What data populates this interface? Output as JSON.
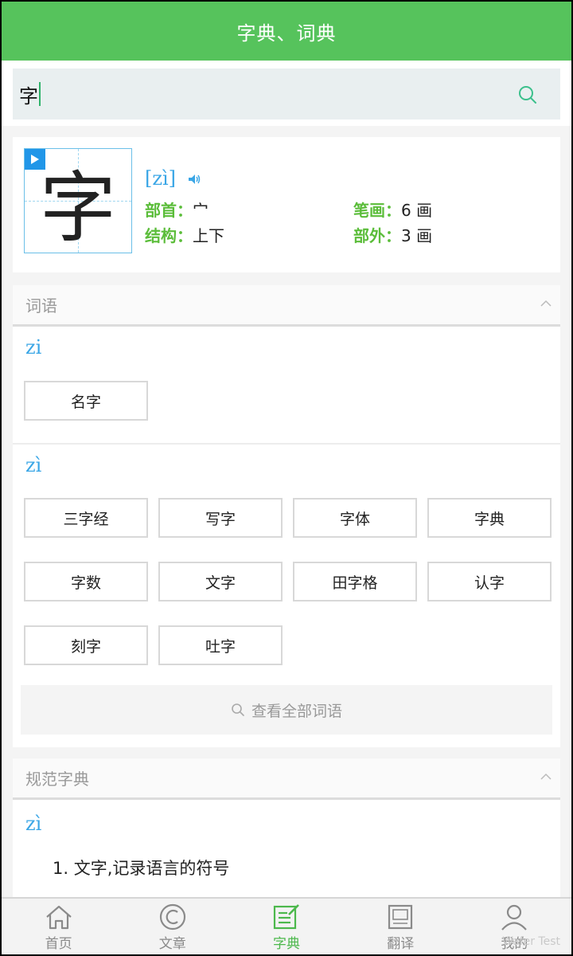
{
  "header": {
    "title": "字典、词典"
  },
  "search": {
    "value": "字"
  },
  "char_card": {
    "character": "字",
    "pinyin": "[zì]",
    "radical_label": "部首：",
    "radical_value": "宀",
    "strokes_label": "笔画：",
    "strokes_value": "6 画",
    "structure_label": "结构：",
    "structure_value": "上下",
    "extra_label": "部外：",
    "extra_value": "3 画"
  },
  "words": {
    "heading": "词语",
    "groups": [
      {
        "pinyin": "zi",
        "items": [
          "名字"
        ]
      },
      {
        "pinyin": "zì",
        "items": [
          "三字经",
          "写字",
          "字体",
          "字典",
          "字数",
          "文字",
          "田字格",
          "认字",
          "刻字",
          "吐字"
        ]
      }
    ],
    "view_all": "查看全部词语"
  },
  "dictionary": {
    "heading": "规范字典",
    "pinyin": "zì",
    "definitions": [
      "1. 文字,记录语言的符号"
    ]
  },
  "nav": {
    "items": [
      {
        "label": "首页",
        "icon": "home-icon"
      },
      {
        "label": "文章",
        "icon": "copyright-icon"
      },
      {
        "label": "字典",
        "icon": "edit-note-icon",
        "active": true
      },
      {
        "label": "翻译",
        "icon": "translate-card-icon"
      },
      {
        "label": "我的",
        "icon": "user-icon"
      }
    ],
    "active_color": "#4cb84c"
  },
  "watermark": "Wafer Test",
  "colors": {
    "header": "#56c35c",
    "accent_blue": "#3aa6e6",
    "label_green": "#5bbd3a"
  }
}
